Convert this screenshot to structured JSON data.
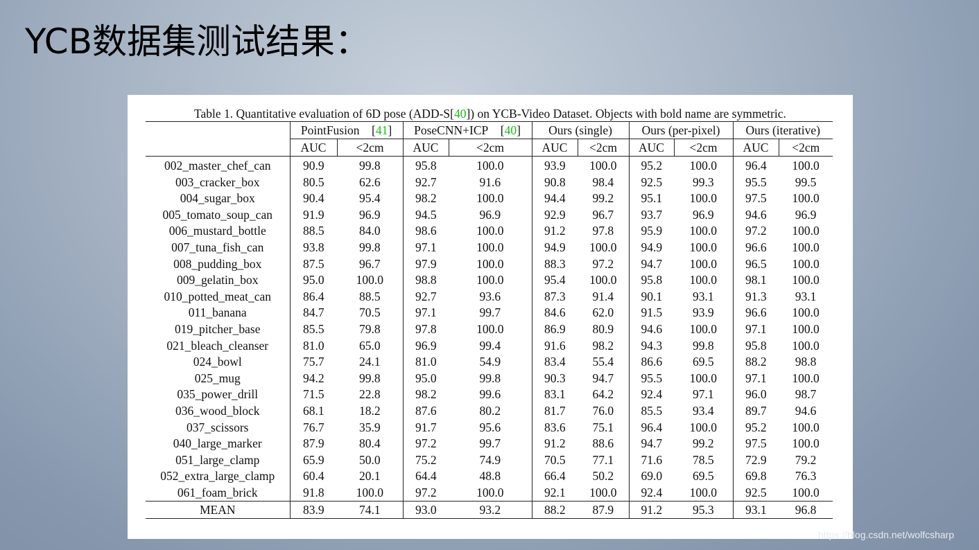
{
  "slide": {
    "title": "YCB数据集测试结果："
  },
  "caption": {
    "before": "Table 1. Quantitative evaluation of 6D pose (ADD-S[",
    "cite": "40",
    "after": "]) on YCB-Video Dataset. Objects with bold name are symmetric."
  },
  "colors": {
    "citation": "#1fb81f",
    "panel": "#ffffff",
    "slide_bg": "#a9b6c6"
  },
  "columns": [
    {
      "name": "PointFusion",
      "cite": "41"
    },
    {
      "name": "PoseCNN+ICP",
      "cite": "40"
    },
    {
      "name": "Ours (single)"
    },
    {
      "name": "Ours (per-pixel)"
    },
    {
      "name": "Ours (iterative)"
    }
  ],
  "metrics": [
    "AUC",
    "<2cm"
  ],
  "rows": [
    {
      "name": "002_master_chef_can",
      "bold": false,
      "v": [
        "90.9",
        "99.8",
        "95.8",
        "100.0",
        "93.9",
        "100.0",
        "95.2",
        "100.0",
        "96.4",
        "100.0"
      ],
      "b": [
        8
      ]
    },
    {
      "name": "003_cracker_box",
      "bold": false,
      "v": [
        "80.5",
        "62.6",
        "92.7",
        "91.6",
        "90.8",
        "98.4",
        "92.5",
        "99.3",
        "95.5",
        "99.5"
      ],
      "b": [
        8,
        9
      ]
    },
    {
      "name": "004_sugar_box",
      "bold": false,
      "v": [
        "90.4",
        "95.4",
        "98.2",
        "100.0",
        "94.4",
        "99.2",
        "95.1",
        "100.0",
        "97.5",
        "100.0"
      ],
      "b": [
        2
      ]
    },
    {
      "name": "005_tomato_soup_can",
      "bold": false,
      "v": [
        "91.9",
        "96.9",
        "94.5",
        "96.9",
        "92.9",
        "96.7",
        "93.7",
        "96.9",
        "94.6",
        "96.9"
      ],
      "b": [
        8
      ]
    },
    {
      "name": "006_mustard_bottle",
      "bold": false,
      "v": [
        "88.5",
        "84.0",
        "98.6",
        "100.0",
        "91.2",
        "97.8",
        "95.9",
        "100.0",
        "97.2",
        "100.0"
      ],
      "b": [
        2
      ]
    },
    {
      "name": "007_tuna_fish_can",
      "bold": false,
      "v": [
        "93.8",
        "99.8",
        "97.1",
        "100.0",
        "94.9",
        "100.0",
        "94.9",
        "100.0",
        "96.6",
        "100.0"
      ],
      "b": [
        2
      ]
    },
    {
      "name": "008_pudding_box",
      "bold": false,
      "v": [
        "87.5",
        "96.7",
        "97.9",
        "100.0",
        "88.3",
        "97.2",
        "94.7",
        "100.0",
        "96.5",
        "100.0"
      ],
      "b": [
        2
      ]
    },
    {
      "name": "009_gelatin_box",
      "bold": false,
      "v": [
        "95.0",
        "100.0",
        "98.8",
        "100.0",
        "95.4",
        "100.0",
        "95.8",
        "100.0",
        "98.1",
        "100.0"
      ],
      "b": [
        2
      ]
    },
    {
      "name": "010_potted_meat_can",
      "bold": false,
      "v": [
        "86.4",
        "88.5",
        "92.7",
        "93.6",
        "87.3",
        "91.4",
        "90.1",
        "93.1",
        "91.3",
        "93.1"
      ],
      "b": [
        2,
        3
      ]
    },
    {
      "name": "011_banana",
      "bold": false,
      "v": [
        "84.7",
        "70.5",
        "97.1",
        "99.7",
        "84.6",
        "62.0",
        "91.5",
        "93.9",
        "96.6",
        "100.0"
      ],
      "b": [
        2,
        9
      ]
    },
    {
      "name": "019_pitcher_base",
      "bold": false,
      "v": [
        "85.5",
        "79.8",
        "97.8",
        "100.0",
        "86.9",
        "80.9",
        "94.6",
        "100.0",
        "97.1",
        "100.0"
      ],
      "b": [
        2
      ]
    },
    {
      "name": "021_bleach_cleanser",
      "bold": false,
      "v": [
        "81.0",
        "65.0",
        "96.9",
        "99.4",
        "91.6",
        "98.2",
        "94.3",
        "99.8",
        "95.8",
        "100.0"
      ],
      "b": [
        2,
        9
      ]
    },
    {
      "name": "024_bowl",
      "bold": true,
      "v": [
        "75.7",
        "24.1",
        "81.0",
        "54.9",
        "83.4",
        "55.4",
        "86.6",
        "69.5",
        "88.2",
        "98.8"
      ],
      "b": [
        8,
        9
      ]
    },
    {
      "name": "025_mug",
      "bold": false,
      "v": [
        "94.2",
        "99.8",
        "95.0",
        "99.8",
        "90.3",
        "94.7",
        "95.5",
        "100.0",
        "97.1",
        "100.0"
      ],
      "b": [
        7,
        8,
        9
      ]
    },
    {
      "name": "035_power_drill",
      "bold": false,
      "v": [
        "71.5",
        "22.8",
        "98.2",
        "99.6",
        "83.1",
        "64.2",
        "92.4",
        "97.1",
        "96.0",
        "98.7"
      ],
      "b": [
        2,
        3
      ]
    },
    {
      "name": "036_wood_block",
      "bold": true,
      "v": [
        "68.1",
        "18.2",
        "87.6",
        "80.2",
        "81.7",
        "76.0",
        "85.5",
        "93.4",
        "89.7",
        "94.6"
      ],
      "b": [
        8,
        9
      ]
    },
    {
      "name": "037_scissors",
      "bold": false,
      "v": [
        "76.7",
        "35.9",
        "91.7",
        "95.6",
        "83.6",
        "75.1",
        "96.4",
        "100.0",
        "95.2",
        "100.0"
      ],
      "b": [
        7,
        8,
        9
      ]
    },
    {
      "name": "040_large_marker",
      "bold": false,
      "v": [
        "87.9",
        "80.4",
        "97.2",
        "99.7",
        "91.2",
        "88.6",
        "94.7",
        "99.2",
        "97.5",
        "100.0"
      ],
      "b": [
        8,
        9
      ]
    },
    {
      "name": "051_large_clamp",
      "bold": true,
      "v": [
        "65.9",
        "50.0",
        "75.2",
        "74.9",
        "70.5",
        "77.1",
        "71.6",
        "78.5",
        "72.9",
        "79.2"
      ],
      "b": [
        2,
        9
      ]
    },
    {
      "name": "052_extra_large_clamp",
      "bold": true,
      "v": [
        "60.4",
        "20.1",
        "64.4",
        "48.8",
        "66.4",
        "50.2",
        "69.0",
        "69.5",
        "69.8",
        "76.3"
      ],
      "b": [
        8,
        9
      ]
    },
    {
      "name": "061_foam_brick",
      "bold": true,
      "v": [
        "91.8",
        "100.0",
        "97.2",
        "100.0",
        "92.1",
        "100.0",
        "92.4",
        "100.0",
        "92.5",
        "100.0"
      ],
      "b": [
        2
      ]
    }
  ],
  "mean": {
    "name": "MEAN",
    "v": [
      "83.9",
      "74.1",
      "93.0",
      "93.2",
      "88.2",
      "87.9",
      "91.2",
      "95.3",
      "93.1",
      "96.8"
    ],
    "b": [
      8,
      9
    ]
  },
  "watermark": "https://blog.csdn.net/wolfcsharp"
}
